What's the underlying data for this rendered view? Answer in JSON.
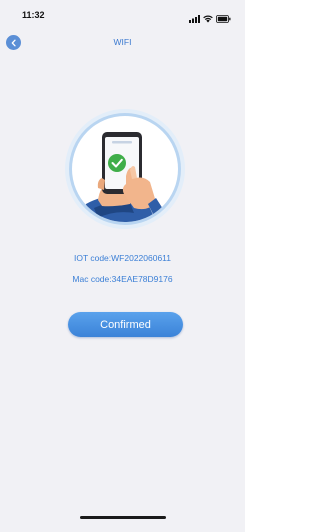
{
  "status_bar": {
    "time": "11:32",
    "icons": [
      "cellular-signal-icon",
      "wifi-icon",
      "battery-icon"
    ]
  },
  "nav": {
    "title": "WIFI",
    "back_icon": "chevron-left-icon"
  },
  "illustration": {
    "icon": "phone-check-hand-illustration",
    "accent_color": "#3fae49"
  },
  "device_info": {
    "iot_code": "IOT code:WF2022060611",
    "mac_code": "Mac code:34EAE78D9176"
  },
  "actions": {
    "confirm_label": "Confirmed"
  },
  "colors": {
    "background": "#f1f1f5",
    "primary": "#3b7fd6",
    "button_gradient_top": "#5aa2ec",
    "button_gradient_bottom": "#3a82d8"
  }
}
